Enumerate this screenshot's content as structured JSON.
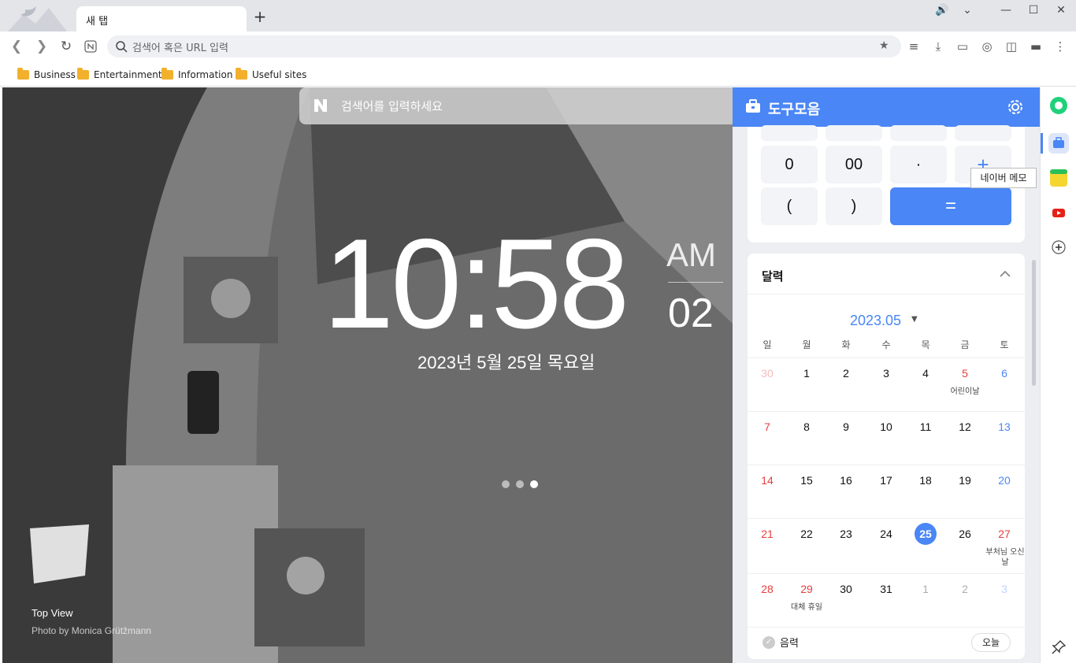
{
  "tab": {
    "title": "새 탭",
    "new_tab": "+"
  },
  "window": {
    "minimize": "—",
    "maximize": "☐",
    "close": "✕",
    "sound": "🔊",
    "menu": "⌄"
  },
  "address": {
    "placeholder": "검색어 혹은 URL 입력"
  },
  "bookmarks": [
    "Business",
    "Entertainment",
    "Information",
    "Useful sites"
  ],
  "page": {
    "search_placeholder": "검색어를 입력하세요",
    "clock": "10:58",
    "ampm": "AM",
    "seconds": "02",
    "date": "2023년 5월 25일 목요일",
    "caption": "Top View",
    "credit": "Photo by Monica Grütžmann"
  },
  "panel": {
    "title": "도구모음",
    "calculator": {
      "keys": [
        "0",
        "00",
        "·",
        "+",
        "(",
        ")",
        "="
      ]
    },
    "calendar": {
      "title": "달력",
      "month": "2023.05",
      "weekdays": [
        "일",
        "월",
        "화",
        "수",
        "목",
        "금",
        "토"
      ],
      "weeks": [
        [
          "30",
          "1",
          "2",
          "3",
          "4",
          "5",
          "6"
        ],
        [
          "7",
          "8",
          "9",
          "10",
          "11",
          "12",
          "13"
        ],
        [
          "14",
          "15",
          "16",
          "17",
          "18",
          "19",
          "20"
        ],
        [
          "21",
          "22",
          "23",
          "24",
          "25",
          "26",
          "27"
        ],
        [
          "28",
          "29",
          "30",
          "31",
          "1",
          "2",
          "3"
        ]
      ],
      "notes": {
        "childrens_day": "어린이날",
        "buddha": "부처님 오신 날",
        "substitute": "대체 휴일"
      },
      "lunar": "음력",
      "today": "오늘"
    }
  },
  "tooltip": "네이버 메모",
  "colors": {
    "accent": "#4a86f5",
    "holiday": "#e63e3e"
  }
}
